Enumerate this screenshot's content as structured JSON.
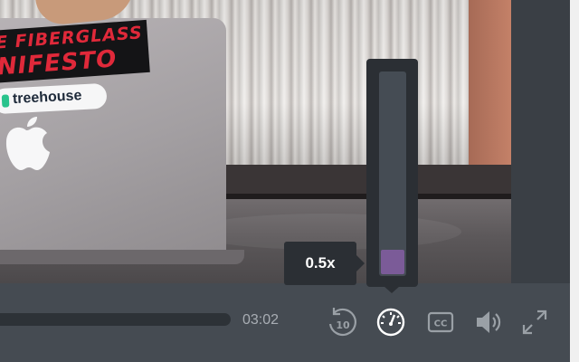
{
  "video": {
    "sticker_line1": "E FIBERGLASS",
    "sticker_line2": "NIFESTO",
    "sticker_treehouse": "treehouse"
  },
  "controls": {
    "current_time": "03:02",
    "speed": {
      "label": "0.5x",
      "level_fraction": 0.12
    },
    "icons": {
      "rewind": "rewind-10-icon",
      "rewind_label": "10",
      "speed": "playback-speed-gauge-icon",
      "captions": "closed-captions-icon",
      "captions_label": "CC",
      "volume": "volume-icon",
      "fullscreen": "fullscreen-icon"
    }
  },
  "colors": {
    "control_bar": "#454b52",
    "popup_bg": "#2b2f34",
    "speed_fill": "#7b5b98",
    "icon": "#9aa0a6",
    "active_icon": "#ffffff"
  }
}
